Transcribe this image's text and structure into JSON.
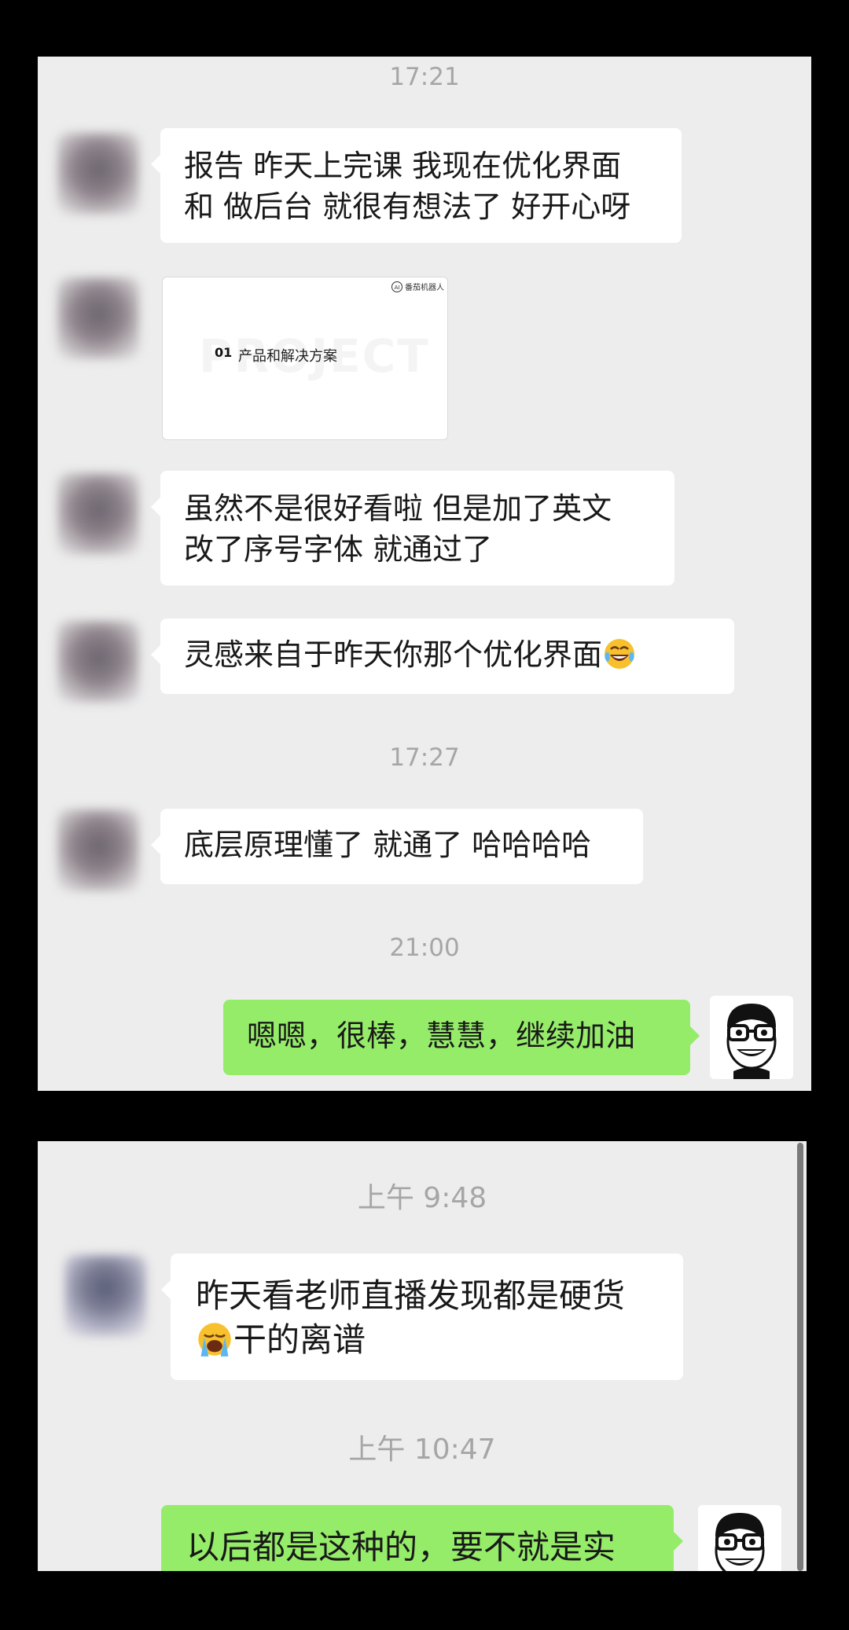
{
  "panel1": {
    "timestamps": [
      "17:21",
      "17:27",
      "21:00"
    ],
    "messages": [
      "报告 昨天上完课 我现在优化界面",
      "和 做后台 就很有想法了 好开心呀",
      "虽然不是很好看啦 但是加了英文",
      "改了序号字体 就通过了",
      "灵感来自于昨天你那个优化界面",
      "底层原理懂了 就通了 哈哈哈哈",
      "嗯嗯，很棒，慧慧，继续加油"
    ],
    "image_message": {
      "watermark": "PROJECT",
      "number": "01",
      "title": "产品和解决方案",
      "logo_text": "番茄机器人"
    }
  },
  "panel2": {
    "timestamps": [
      "上午 9:48",
      "上午 10:47"
    ],
    "messages": [
      "昨天看老师直播发现都是硬货",
      "干的离谱",
      "以后都是这种的，要不就是实"
    ]
  },
  "icons": {
    "laughing_emoji": "face-with-tears-of-joy-icon",
    "crying_emoji": "loudly-crying-face-icon",
    "self_avatar": "cartoon-glasses-man-avatar"
  },
  "colors": {
    "chat_background": "#ededed",
    "incoming_bubble": "#ffffff",
    "outgoing_bubble": "#95ec69",
    "timestamp_text": "#a6a6a6",
    "frame": "#000000"
  }
}
